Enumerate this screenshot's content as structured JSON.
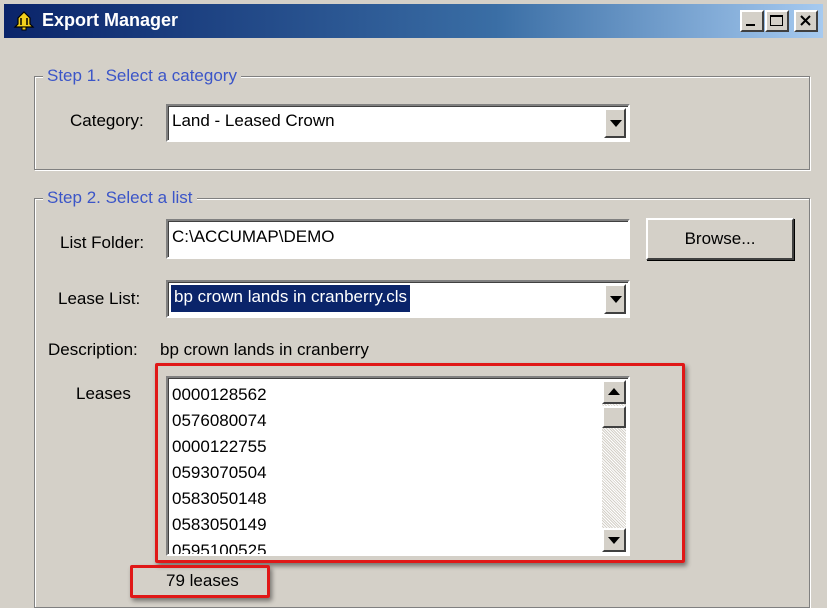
{
  "window": {
    "title": "Export Manager",
    "icon": "bell-icon"
  },
  "step1": {
    "legend": "Step 1.  Select a category",
    "category_label": "Category:",
    "category_value": "Land - Leased Crown"
  },
  "step2": {
    "legend": "Step 2.  Select a list",
    "list_folder_label": "List Folder:",
    "list_folder_value": "C:\\ACCUMAP\\DEMO",
    "browse_label": "Browse...",
    "lease_list_label": "Lease List:",
    "lease_list_value": "bp crown lands in cranberry.cls",
    "description_label": "Description:",
    "description_value": "bp crown lands in cranberry",
    "leases_label": "Leases",
    "leases": [
      "0000128562",
      "0576080074",
      "0000122755",
      "0593070504",
      "0583050148",
      "0583050149",
      "0595100525"
    ],
    "lease_count": "79 leases"
  },
  "colors": {
    "highlight_box": "#e01818",
    "group_legend": "#3b55c8",
    "selection": "#0a246a"
  }
}
